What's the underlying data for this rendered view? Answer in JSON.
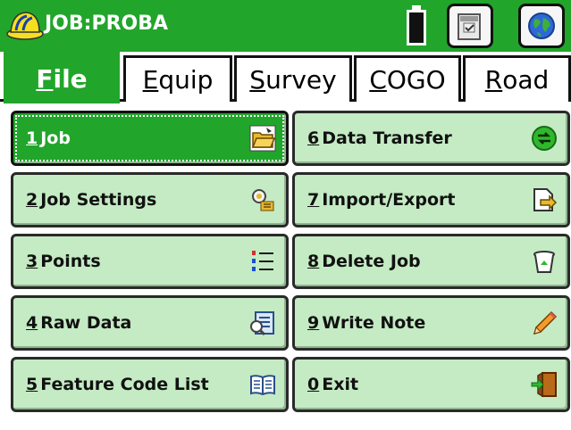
{
  "titlebar": {
    "title": "JOB:PROBA",
    "hardhat_icon": "hardhat-icon",
    "battery_icon": "battery-icon",
    "tools_icon": "tools-icon",
    "globe_icon": "globe-icon"
  },
  "tabs": [
    {
      "first": "F",
      "rest": "ile",
      "active": true
    },
    {
      "first": "E",
      "rest": "quip",
      "active": false
    },
    {
      "first": "S",
      "rest": "urvey",
      "active": false
    },
    {
      "first": "C",
      "rest": "OGO",
      "active": false
    },
    {
      "first": "R",
      "rest": "oad",
      "active": false
    }
  ],
  "menu": [
    {
      "num": "1",
      "label": "Job",
      "icon": "folder-open-icon",
      "selected": true
    },
    {
      "num": "2",
      "label": "Job Settings",
      "icon": "settings-icon"
    },
    {
      "num": "3",
      "label": "Points",
      "icon": "numbered-list-icon"
    },
    {
      "num": "4",
      "label": "Raw Data",
      "icon": "raw-data-icon"
    },
    {
      "num": "5",
      "label": "Feature Code List",
      "icon": "book-icon"
    },
    {
      "num": "6",
      "label": "Data Transfer",
      "icon": "transfer-icon"
    },
    {
      "num": "7",
      "label": "Import/Export",
      "icon": "import-export-icon"
    },
    {
      "num": "8",
      "label": "Delete Job",
      "icon": "trash-icon"
    },
    {
      "num": "9",
      "label": "Write Note",
      "icon": "pencil-icon"
    },
    {
      "num": "0",
      "label": "Exit",
      "icon": "exit-door-icon"
    }
  ],
  "colors": {
    "accent": "#22a52b",
    "button_bg": "#c4ebc3"
  }
}
